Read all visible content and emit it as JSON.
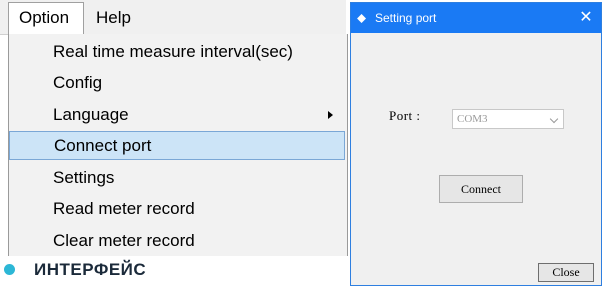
{
  "menubar": {
    "option_label": "Option",
    "help_label": "Help"
  },
  "option_menu": {
    "items": [
      {
        "label": "Real time measure interval(sec)",
        "has_submenu": false,
        "selected": false
      },
      {
        "label": "Config",
        "has_submenu": false,
        "selected": false
      },
      {
        "label": "Language",
        "has_submenu": true,
        "selected": false
      },
      {
        "label": "Connect port",
        "has_submenu": false,
        "selected": true
      },
      {
        "label": "Settings",
        "has_submenu": false,
        "selected": false
      },
      {
        "label": "Read meter record",
        "has_submenu": false,
        "selected": false
      },
      {
        "label": "Clear meter record",
        "has_submenu": false,
        "selected": false
      }
    ]
  },
  "footer": {
    "text": "ИНТЕРФЕЙС",
    "bullet_color": "#2cb7d6"
  },
  "dialog": {
    "title": "Setting port",
    "title_icon": "settings-diamond-icon",
    "close_glyph": "✕",
    "port_label": "Port :",
    "port_value": "COM3",
    "connect_label": "Connect",
    "close_label": "Close",
    "titlebar_color": "#1a7af4"
  },
  "colors": {
    "selected_item_bg": "#cce4f7",
    "selected_item_border": "#7aa7d6"
  }
}
